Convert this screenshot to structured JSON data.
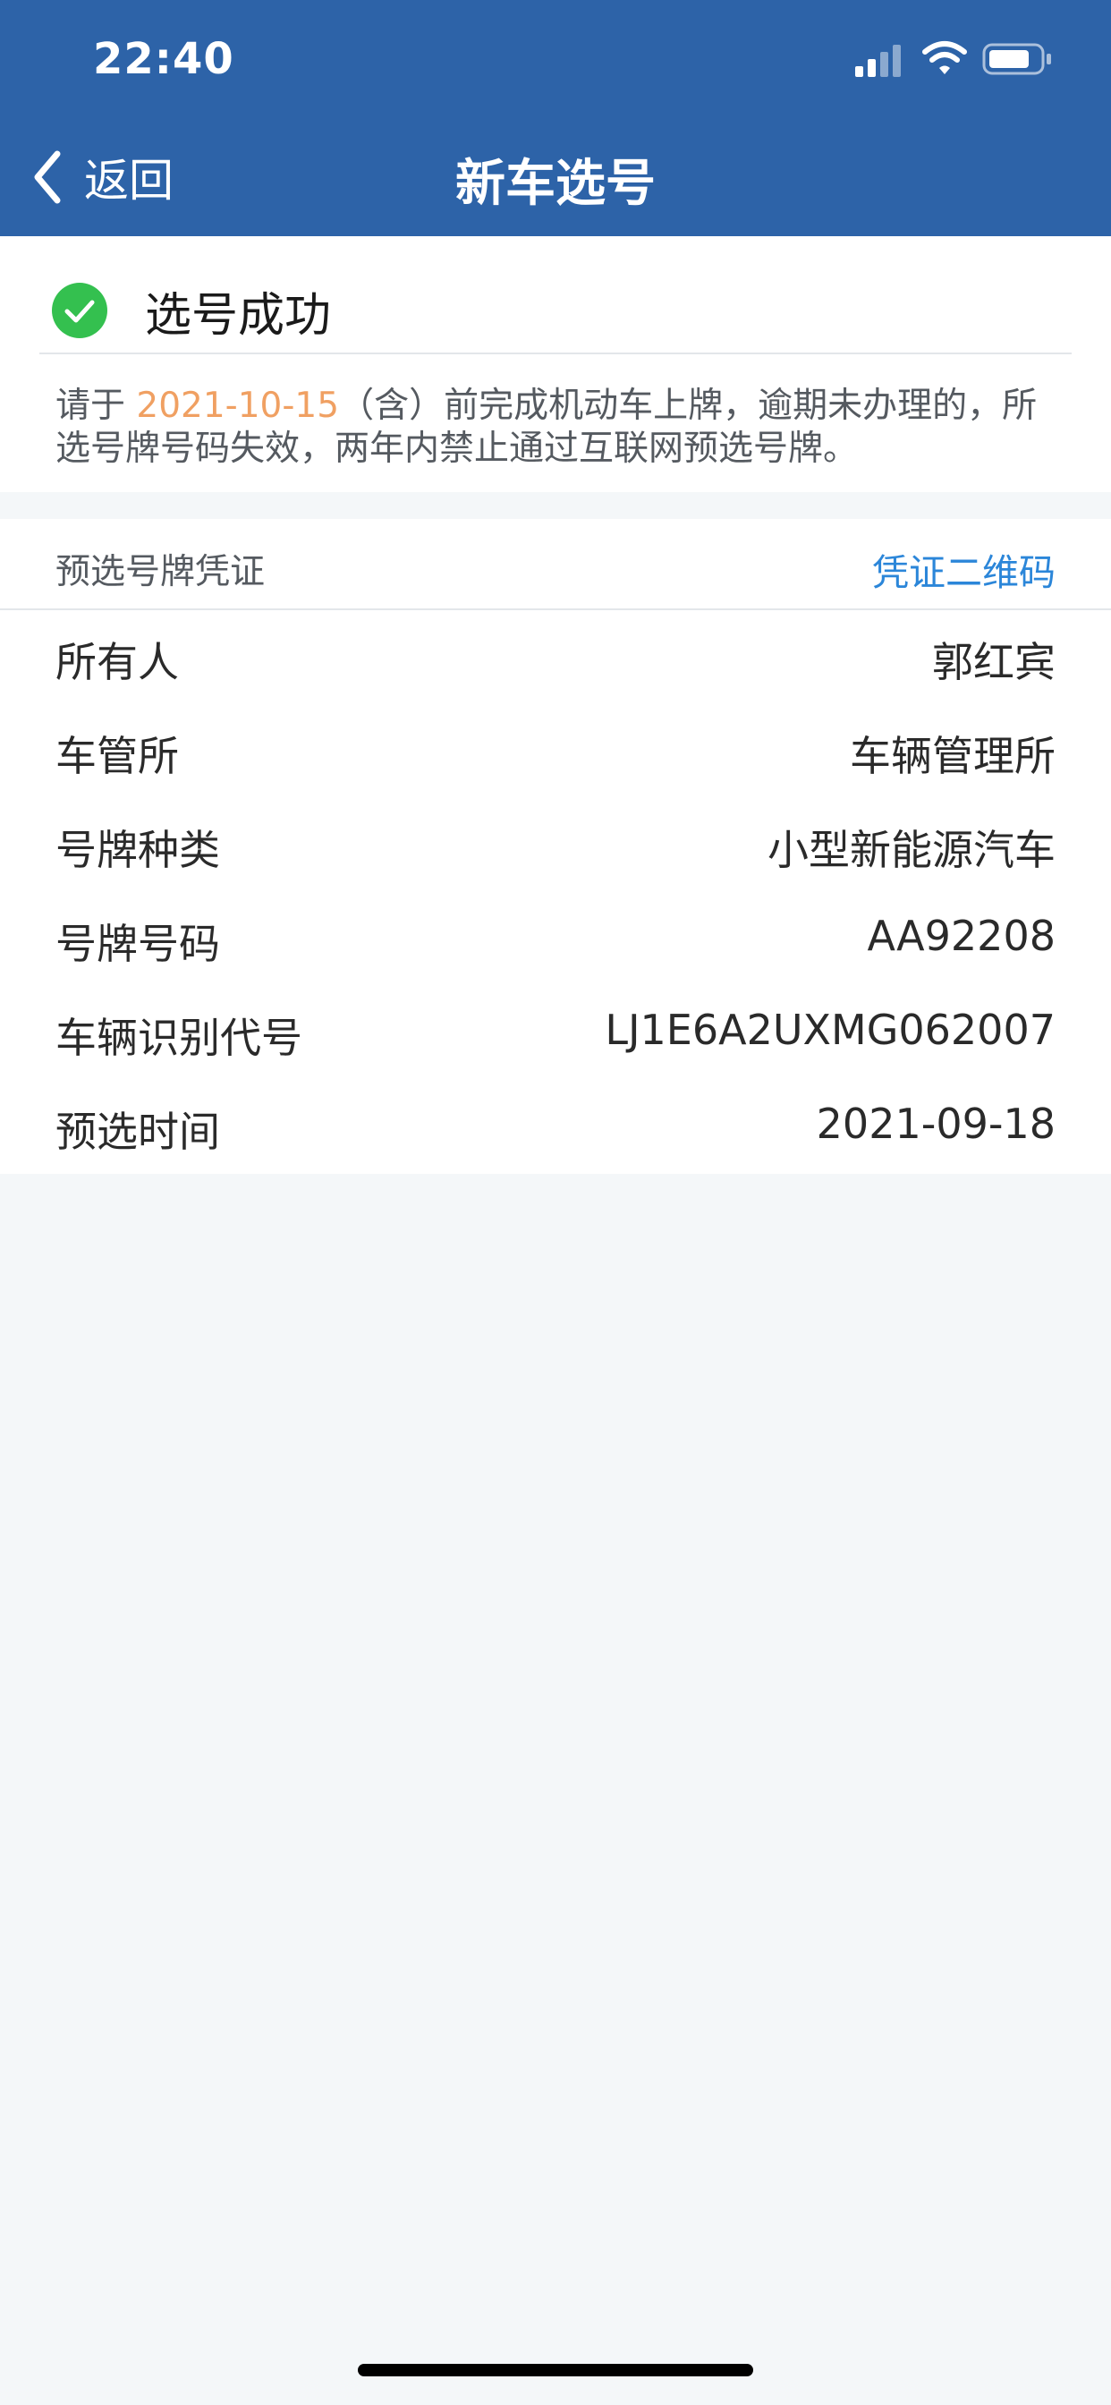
{
  "status_bar": {
    "time": "22:40",
    "icons": [
      "signal-icon",
      "wifi-icon",
      "battery-icon"
    ]
  },
  "nav": {
    "back_label": "返回",
    "title": "新车选号"
  },
  "success": {
    "text": "选号成功",
    "notice_prefix": "请于 ",
    "notice_date": "2021-10-15",
    "notice_suffix": "（含）前完成机动车上牌，逾期未办理的，所选号牌号码失效，两年内禁止通过互联网预选号牌。"
  },
  "voucher": {
    "section_title": "预选号牌凭证",
    "qr_link": "凭证二维码",
    "rows": [
      {
        "label": "所有人",
        "value": "郭红宾"
      },
      {
        "label": "车管所",
        "value": "车辆管理所"
      },
      {
        "label": "号牌种类",
        "value": "小型新能源汽车"
      },
      {
        "label": "号牌号码",
        "value": "AA92208"
      },
      {
        "label": "车辆识别代号",
        "value": "LJ1E6A2UXMG062007"
      },
      {
        "label": "预选时间",
        "value": "2021-09-18"
      }
    ]
  },
  "colors": {
    "header": "#2d63a8",
    "success_green": "#34c04f",
    "accent_link": "#2b86d9",
    "date_highlight": "#f0a062",
    "background": "#f4f7f9"
  }
}
